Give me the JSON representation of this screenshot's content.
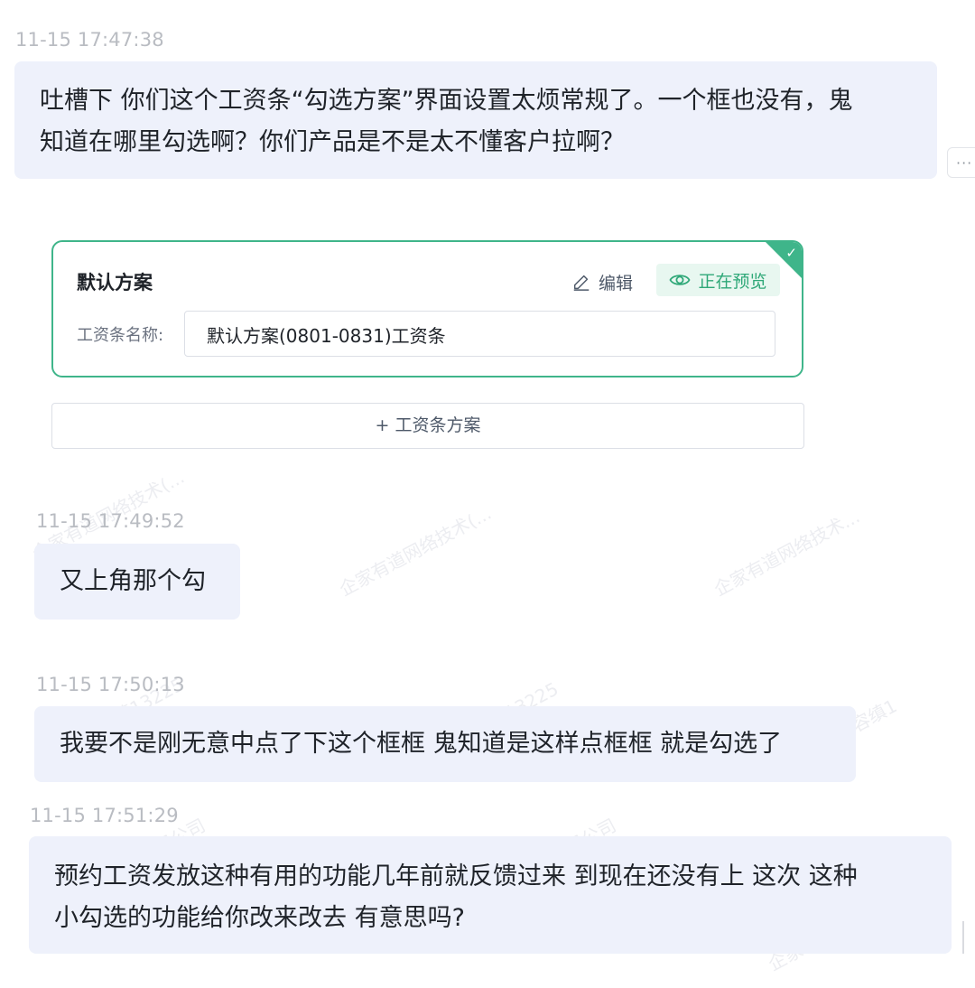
{
  "messages": [
    {
      "timestamp": "11-15 17:47:38",
      "lines": [
        "吐槽下 你们这个工资条“勾选方案”界面设置太烦常规了。一个框也没有，鬼",
        "知道在哪里勾选啊？你们产品是不是太不懂客户拉啊？"
      ]
    },
    {
      "timestamp": "11-15 17:49:52",
      "lines": [
        "又上角那个勾"
      ]
    },
    {
      "timestamp": "11-15 17:50:13",
      "lines": [
        "我要不是刚无意中点了下这个框框 鬼知道是这样点框框 就是勾选了"
      ]
    },
    {
      "timestamp": "11-15 17:51:29",
      "lines": [
        "预约工资发放这种有用的功能几年前就反馈过来 到现在还没有上 这次 这种",
        "小勾选的功能给你改来改去 有意思吗?"
      ]
    }
  ],
  "more_button": {
    "label": "···",
    "icon": "more-icon"
  },
  "plan_card": {
    "title": "默认方案",
    "edit_label": "编辑",
    "edit_icon": "pencil-icon",
    "preview_label": "正在预览",
    "preview_icon": "eye-icon",
    "name_label": "工资条名称:",
    "name_value": "默认方案(0801-0831)工资条",
    "selected_icon": "check-icon",
    "accent_color": "#3fb58a"
  },
  "add_plan_label": "+ 工资条方案",
  "watermarks": [
    "企家有道网络技术(...",
    "企家有道网络技术(...",
    "企家有道网络技术...",
    "部容缜13225",
    "部容缜13225",
    "部容缜1",
    "司有限公司",
    "司有限公司",
    "企家有道网络技术"
  ]
}
